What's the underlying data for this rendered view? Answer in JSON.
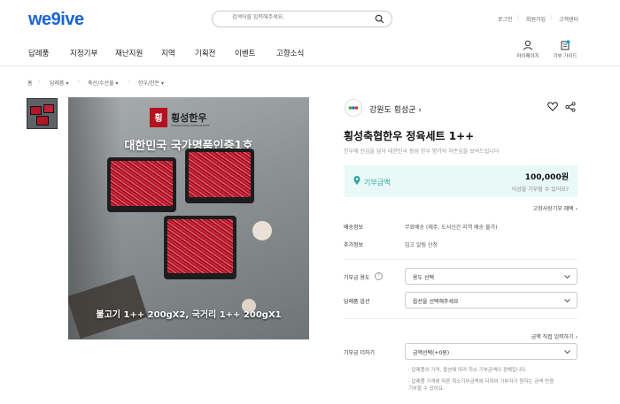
{
  "header": {
    "logo": "we9ive",
    "search_placeholder": "검색어를 입력해주세요.",
    "util_links": [
      "로그인",
      "회원가입",
      "고객센터"
    ],
    "nav": [
      "답례품",
      "지정기부",
      "재난지원",
      "지역",
      "기획전",
      "이벤트",
      "고향소식"
    ],
    "mypage_label": "마이페이지",
    "guide_label": "기부 가이드"
  },
  "breadcrumb": [
    "홈",
    "답례품",
    "축산/수산물",
    "한우/한돈"
  ],
  "image": {
    "brand_text": "횡성한우",
    "brand_sub": "HOENGSEONG KOREAN BEEF",
    "headline": "대한민국 국가명품인증1호",
    "caption": "불고기 1++ 200gX2, 국거리 1++ 200gX1"
  },
  "product": {
    "seller": "강원도 횡성군",
    "title": "횡성축협한우 정육세트 1++",
    "description": "한우에 진심을 담아 대한민국 횡성 한우 명가의 자존심을 보여드립니다",
    "price_label": "기부금액",
    "price": "100,000원",
    "price_question": "이상을 기부할 수 있어요?",
    "benefit_link": "고향사랑기부 혜택"
  },
  "info": {
    "shipping_label": "배송정보",
    "shipping_value": "무료배송 (제주, 도서산간 지역 배송 불가)",
    "extra_label": "추가정보",
    "extra_value": "입고 알림 신청"
  },
  "form": {
    "usage_label": "기부금 용도",
    "usage_value": "용도 선택",
    "option_label": "답례품 옵션",
    "option_value": "옵션을 선택해주세요",
    "direct_link": "금액 직접 입력하기",
    "add_label": "기부금 더하기",
    "add_value": "금액선택(+0원)",
    "notes": [
      "· 답례품의 가격, 옵션에 따라 최소 기부금액이 정해집니다.",
      "· 답례품 가격에 따른 최소기부금액에 더하여 기부자가 원하는 금액 만큼",
      "  기부할 수 있어요."
    ]
  },
  "colors": {
    "brand_blue": "#1a63d8",
    "price_bg": "#e9f9f8",
    "accent_teal": "#2aa39a"
  },
  "icons": [
    "search-icon",
    "user-icon",
    "guide-icon",
    "heart-icon",
    "share-icon",
    "pin-icon",
    "chevron-down-icon",
    "help-icon"
  ]
}
